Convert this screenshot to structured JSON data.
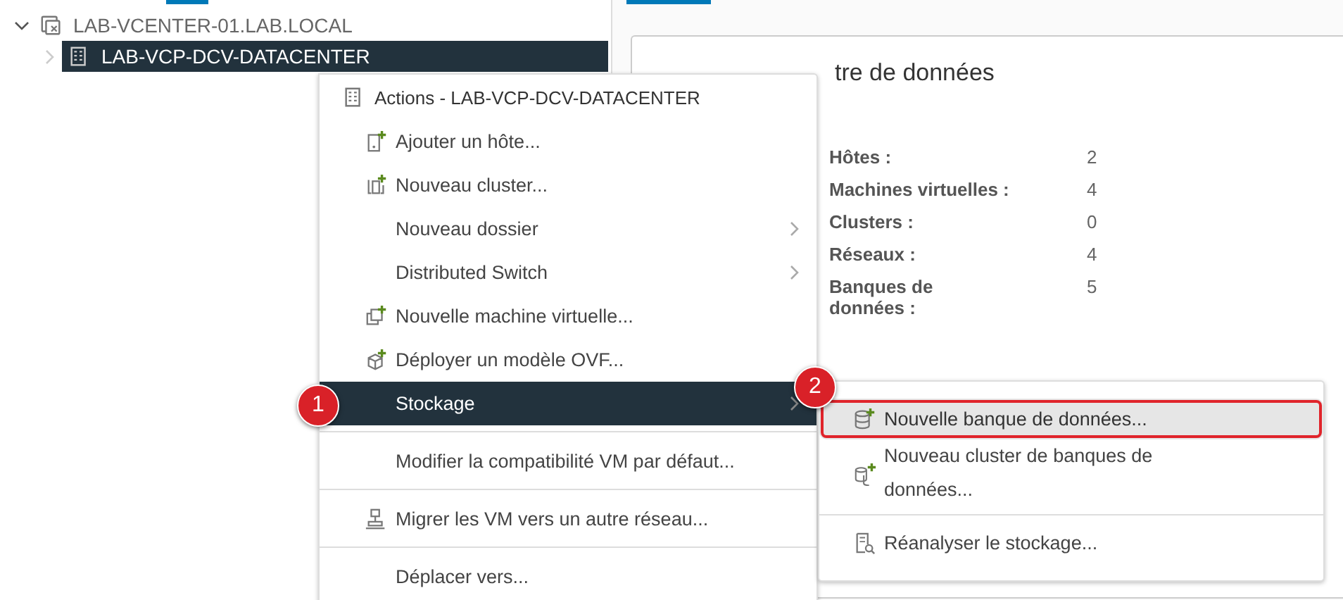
{
  "tree": [
    {
      "label": "LAB-VCENTER-01.LAB.LOCAL",
      "expanded": true,
      "selected": false,
      "children": [
        {
          "label": "LAB-VCP-DCV-DATACENTER",
          "expanded": false,
          "selected": true
        }
      ]
    }
  ],
  "summary": {
    "title": "tre de données",
    "stats": [
      {
        "label": "Hôtes :",
        "value": "2"
      },
      {
        "label": "Machines virtuelles :",
        "value": "4"
      },
      {
        "label": "Clusters :",
        "value": "0"
      },
      {
        "label": "Réseaux :",
        "value": "4"
      },
      {
        "label": "Banques de données :",
        "value": "5"
      }
    ]
  },
  "context_menu": {
    "title": "Actions - LAB-VCP-DCV-DATACENTER",
    "items": [
      {
        "kind": "action",
        "label": "Ajouter un hôte...",
        "selected": false
      },
      {
        "kind": "action",
        "label": "Nouveau cluster...",
        "selected": false
      },
      {
        "kind": "submenu",
        "label": "Nouveau dossier",
        "selected": false
      },
      {
        "kind": "submenu",
        "label": "Distributed Switch",
        "selected": false
      },
      {
        "kind": "action",
        "label": "Nouvelle machine virtuelle...",
        "selected": false
      },
      {
        "kind": "action",
        "label": "Déployer un modèle OVF...",
        "selected": false
      },
      {
        "kind": "submenu",
        "label": "Stockage",
        "selected": true
      },
      {
        "kind": "separator"
      },
      {
        "kind": "action",
        "label": "Modifier la compatibilité VM par défaut...",
        "selected": false
      },
      {
        "kind": "separator"
      },
      {
        "kind": "action",
        "label": "Migrer les VM vers un autre réseau...",
        "selected": false
      },
      {
        "kind": "separator"
      },
      {
        "kind": "action",
        "label": "Déplacer vers...",
        "selected": false
      }
    ]
  },
  "submenu": {
    "items": [
      {
        "kind": "action",
        "label": "Nouvelle banque de données...",
        "selected": true,
        "annotated": true
      },
      {
        "kind": "action",
        "label": "Nouveau cluster de banques de données...",
        "selected": false,
        "annotated": false
      },
      {
        "kind": "separator"
      },
      {
        "kind": "action",
        "label": "Réanalyser le stockage...",
        "selected": false,
        "annotated": false
      }
    ]
  },
  "callouts": [
    {
      "label": "1"
    },
    {
      "label": "2"
    }
  ]
}
